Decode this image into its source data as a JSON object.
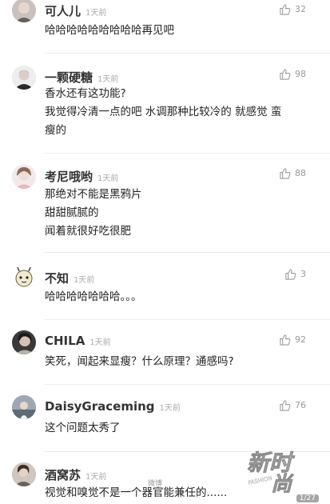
{
  "comments": [
    {
      "name": "可人儿",
      "time": "1天前",
      "likes": "32",
      "lines": [
        "哈哈哈哈哈哈哈哈哈再见吧"
      ]
    },
    {
      "name": "一颗硬糖",
      "time": "1天前",
      "likes": "98",
      "lines": [
        "香水还有这功能?",
        "我觉得冷清一点的吧 水调那种比较冷的 就感觉 蛮",
        "瘦的"
      ]
    },
    {
      "name": "考尼哦哟",
      "time": "1天前",
      "likes": "88",
      "lines": [
        "那绝对不能是黑鸦片",
        "甜甜腻腻的",
        "闻着就很好吃很肥"
      ]
    },
    {
      "name": "不知",
      "time": "1天前",
      "likes": "3",
      "lines": [
        "哈哈哈哈哈哈哈。。。"
      ]
    },
    {
      "name": "CHILA",
      "time": "1天前",
      "likes": "92",
      "lines": [
        "笑死，闻起来显瘦？什么原理？通感吗?"
      ]
    },
    {
      "name": "DaisyGraceming",
      "time": "1天前",
      "likes": "76",
      "lines": [
        "这个问题太秀了"
      ]
    },
    {
      "name": "酒窝苏",
      "time": "1天前",
      "likes": "",
      "lines": [
        "视觉和嗅觉不是一个器官能兼任的......"
      ]
    }
  ],
  "icons": {
    "like": "thumbs-up-icon"
  },
  "watermark": {
    "line1": "新时",
    "line2": "尚",
    "sub": "FASHION"
  },
  "weibo_tag": "微博",
  "page_indicator": "1/27"
}
